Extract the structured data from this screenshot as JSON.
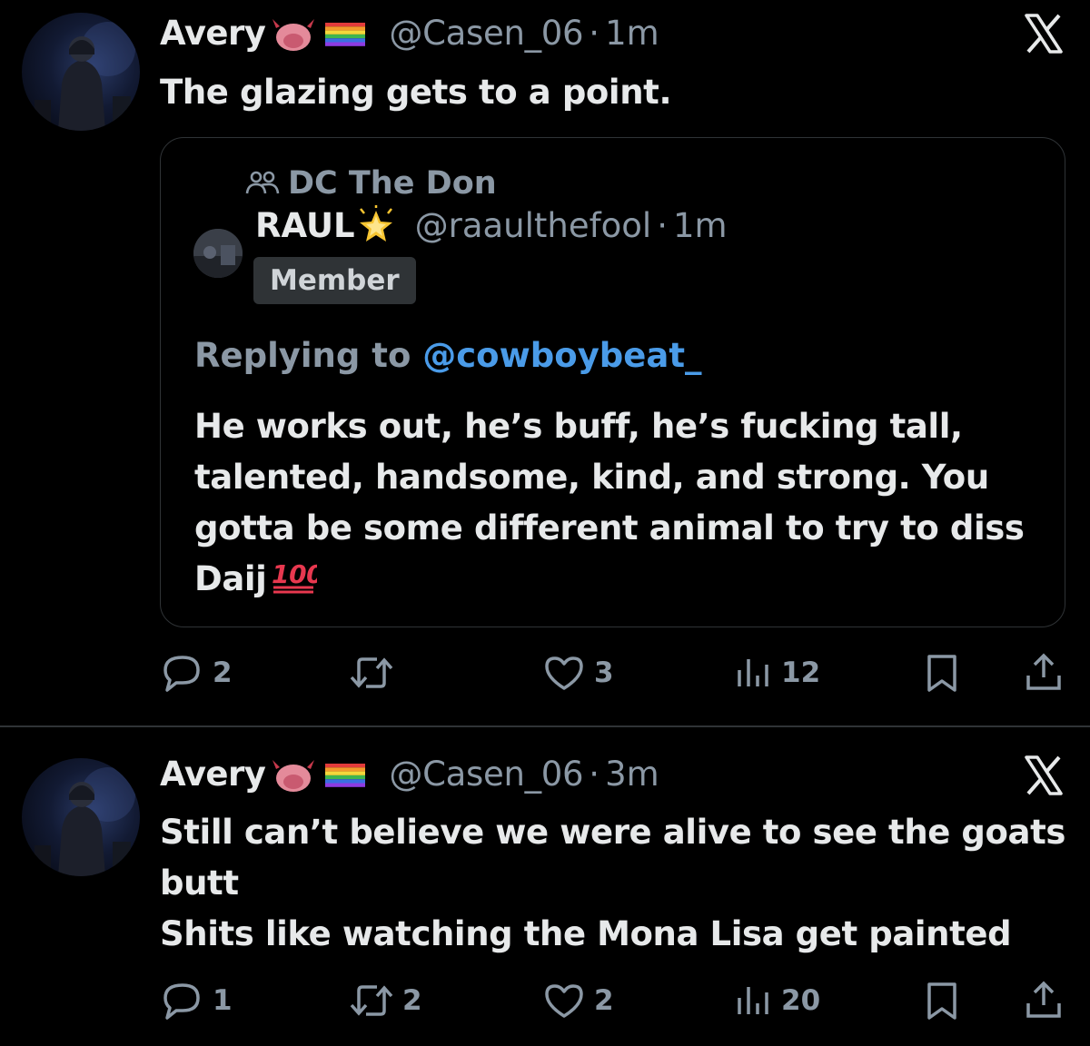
{
  "tweets": [
    {
      "author_name": "Avery",
      "name_emojis": [
        "devil-emoji",
        "rainbow-flag-emoji"
      ],
      "handle": "@Casen_06",
      "separator": "·",
      "time": "1m",
      "text_lines": [
        "The glazing gets to a point."
      ],
      "quote": {
        "community": "DC The Don",
        "author_name": "RAUL",
        "author_emoji": "glowing-star-emoji",
        "handle": "@raaulthefool",
        "separator": "·",
        "time": "1m",
        "badge": "Member",
        "replying_prefix": "Replying to ",
        "replying_handle": "@cowboybeat_",
        "text_lines": [
          "He works out, he’s buff, he’s fucking tall,",
          "talented, handsome, kind, and strong. You",
          "gotta be some different animal to try to diss",
          "Daij"
        ],
        "text_emoji": "hundred-points-emoji"
      },
      "actions": {
        "replies": "2",
        "retweets": "",
        "likes": "3",
        "views": "12"
      }
    },
    {
      "author_name": "Avery",
      "name_emojis": [
        "devil-emoji",
        "rainbow-flag-emoji"
      ],
      "handle": "@Casen_06",
      "separator": "·",
      "time": "3m",
      "text_lines": [
        "Still can’t believe we were alive to see the goats",
        "butt",
        "Shits like watching the Mona Lisa get painted"
      ],
      "actions": {
        "replies": "1",
        "retweets": "2",
        "likes": "2",
        "views": "20"
      }
    }
  ],
  "colors": {
    "background": "#000000",
    "text_primary": "#e7e9ea",
    "text_secondary": "#8b98a5",
    "mention": "#4a9be8",
    "border": "#2f3336"
  }
}
